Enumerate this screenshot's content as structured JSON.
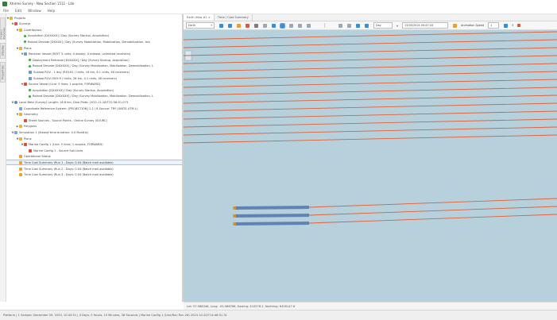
{
  "window": {
    "title": "Xtreme Survey - New Section 1511 - Lite"
  },
  "menu": [
    "File",
    "Edit",
    "Window",
    "Help"
  ],
  "side_tabs": [
    "Project Explorer",
    "Display",
    "Properties"
  ],
  "tree": [
    {
      "indent": 0,
      "expander": "▼",
      "icon": "folder",
      "label": "Projects"
    },
    {
      "indent": 1,
      "expander": "▼",
      "icon": "survey",
      "label": "Surveys"
    },
    {
      "indent": 2,
      "expander": "▼",
      "icon": "folder",
      "label": "Contributors"
    },
    {
      "indent": 3,
      "expander": "",
      "icon": "green",
      "label": "Acquisition [DXXXXX] / Day (Survey Startup, Acquisition)"
    },
    {
      "indent": 3,
      "expander": "",
      "icon": "green",
      "label": "Roland Deviate [DXXXX] / Day (Survey Mobilization, Mobilization, Demobilization, Arb"
    },
    {
      "indent": 2,
      "expander": "▼",
      "icon": "folder",
      "label": "Plans"
    },
    {
      "indent": 3,
      "expander": "▼",
      "icon": "blue",
      "label": "Receiver Vessel (RXYT 5 units; 4 deploy; 4 release, unlimited receivers)"
    },
    {
      "indent": 4,
      "expander": "",
      "icon": "green",
      "label": "Deployment Retrieval [DXXXXX] / Day (Survey Startup, Acquisition)"
    },
    {
      "indent": 4,
      "expander": "",
      "icon": "green",
      "label": "Roland Deviate [DXXXXX] / Day (Survey Mobilization, Mobilization, Demobilization, L"
    },
    {
      "indent": 4,
      "expander": "",
      "icon": "blue",
      "label": "Subsea ROV - 1 day (RXY-61 / Units: 16 km, 8.1 units, 46 receivers)"
    },
    {
      "indent": 4,
      "expander": "",
      "icon": "blue",
      "label": "Subsea ROV (RXY-9 / Units: 26 km, 4.1 units, 46 receivers)"
    },
    {
      "indent": 3,
      "expander": "▼",
      "icon": "red",
      "label": "Source Vessel (Line: 5 lines; 1 acquire, FORWARD)"
    },
    {
      "indent": 4,
      "expander": "",
      "icon": "green",
      "label": "Acquisition [DXXXXX] / Day (Survey Startup, Acquisition)"
    },
    {
      "indent": 4,
      "expander": "",
      "icon": "green",
      "label": "Roland Deviate [DXXXXX] / Day (Survey Mobilization, Mobilization, Demobilization, L"
    },
    {
      "indent": 1,
      "expander": "▼",
      "icon": "globe",
      "label": "Local Beta (Survey) Length: 16.6 km, Dive Plate: 2022-11-28/T22:56:51.073"
    },
    {
      "indent": 2,
      "expander": "",
      "icon": "doc",
      "label": "Coordinate Reference System: [PROJECTION] 1-1 / 8 Source: TRY (UNITS-UTM L)"
    },
    {
      "indent": 2,
      "expander": "▼",
      "icon": "folder",
      "label": "Geometry"
    },
    {
      "indent": 3,
      "expander": "",
      "icon": "red",
      "label": "Sheet Sources - Source Points - Online Survey (SOURC)"
    },
    {
      "indent": 2,
      "expander": "▶",
      "icon": "folder",
      "label": "Polygons"
    },
    {
      "indent": 1,
      "expander": "▼",
      "icon": "doc",
      "label": "Simulation 1 (Steady time duration: 4.0 Months)"
    },
    {
      "indent": 2,
      "expander": "▼",
      "icon": "folder",
      "label": "Plans"
    },
    {
      "indent": 3,
      "expander": "▼",
      "icon": "red",
      "label": "Marine Config 1 (Line: 5 lines; 1 acquire, FORWARD)"
    },
    {
      "indent": 4,
      "expander": "",
      "icon": "red",
      "label": "Marine Config 1 - Source Sail Lines"
    },
    {
      "indent": 2,
      "expander": "",
      "icon": "orange",
      "label": "Operational Status"
    },
    {
      "indent": 2,
      "expander": "",
      "icon": "orange",
      "label": "Time Cost Summary (Run 1 - Days: 0.04 (Batch mail available)",
      "selected": true
    },
    {
      "indent": 2,
      "expander": "",
      "icon": "orange",
      "label": "Time Cost Summary (Run 2 - Days: 0.04 (Batch mail available)"
    },
    {
      "indent": 2,
      "expander": "",
      "icon": "orange",
      "label": "Time Cost Summary (Run 3 - Days: 0.04 (Batch mail available)"
    }
  ],
  "tabs": [
    {
      "label": "Earth View #1 ×",
      "active": true
    },
    {
      "label": "Time / Cost Summary",
      "active": false
    }
  ],
  "toolbar": {
    "view_combo": "Earth",
    "units_combo": "Day",
    "date_combo": "13/05/2024 09:47:18",
    "animation_label": "Animation Speed",
    "speed_combo": "1",
    "zoom_value": "3"
  },
  "colors": {
    "sea": "#b6d0dc",
    "lines": "#e0603a",
    "receiver_lines": "#5f84b3",
    "nodes": "#e8901a"
  },
  "map": {
    "source_line_count": 14,
    "receiver_line_count": 3
  },
  "status": "Lat: 57.988348, Long: -94.586788, Easting: 410578.2, Northing: 6428147.6",
  "bottom": "Platform | 1 Sample: December 09, 2023, 10:43:51 | 4 Days, 0 Hours, 15 Minutes, 38 Seconds | Marine Config 1 (Line/Run Run 26) 2023-10-20/T14:48:51.31",
  "gauge": "Day"
}
